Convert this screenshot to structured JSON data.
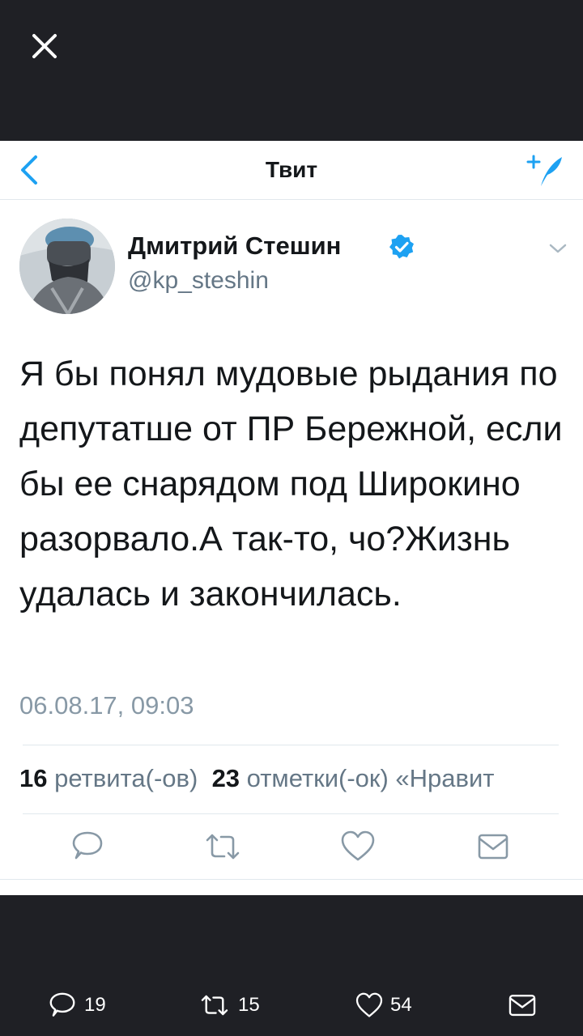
{
  "viewer": {
    "close_icon": "close-icon",
    "counts": {
      "replies": "19",
      "retweets": "15",
      "likes": "54"
    }
  },
  "navbar": {
    "title": "Твит",
    "back_icon": "chevron-left-icon",
    "compose_icon": "compose-tweet-icon"
  },
  "author": {
    "name": "Дмитрий Стешин",
    "handle": "@kp_steshin",
    "verified": true
  },
  "tweet": {
    "text": "Я бы понял мудовые рыдания по депутатше от ПР Бережной, если бы ее снарядом под Широкино разорвало.А так-то, чо?Жизнь удалась и закончилась.",
    "timestamp": "06.08.17, 09:03"
  },
  "stats": {
    "retweets_count": "16",
    "retweets_label": "ретвита(-ов)",
    "likes_count": "23",
    "likes_label": "отметки(-ок) «Нравит"
  },
  "colors": {
    "brand": "#1da1f2",
    "text": "#14171a",
    "muted": "#657786",
    "background": "#1f2025"
  }
}
